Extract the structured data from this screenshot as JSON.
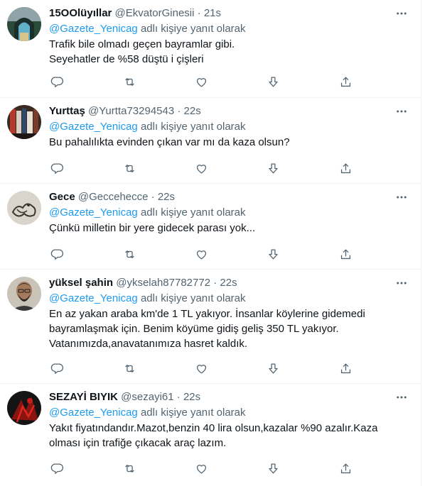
{
  "reply_prefix": "adlı kişiye yanıt olarak",
  "tweets": [
    {
      "name": "15OOlüyıllar",
      "handle": "@EkvatorGinesii",
      "time": "21s",
      "reply_to": "@Gazete_Yenicag",
      "lines": [
        "Trafik bile olmadı geçen bayramlar gibi.",
        "Seyehatler de %58 düştü i çişleri"
      ]
    },
    {
      "name": "Yurttaş",
      "handle": "@Yurtta73294543",
      "time": "22s",
      "reply_to": "@Gazete_Yenicag",
      "lines": [
        "Bu pahalılıkta evinden çıkan var mı da kaza olsun?"
      ]
    },
    {
      "name": "Gece",
      "handle": "@Geccehecce",
      "time": "22s",
      "reply_to": "@Gazete_Yenicag",
      "lines": [
        "Çünkü milletin bir yere gidecek parası yok..."
      ]
    },
    {
      "name": "yüksel şahin",
      "handle": "@ykselah87782772",
      "time": "22s",
      "reply_to": "@Gazete_Yenicag",
      "lines": [
        "En az yakan araba km'de 1 TL yakıyor. İnsanlar köylerine gidemedi",
        "bayramlaşmak için. Benim köyüme gidiş geliş 350 TL yakıyor.",
        "Vatanımızda,anavatanımıza hasret kaldık."
      ]
    },
    {
      "name": "SEZAYİ BIYIK",
      "handle": "@sezayi61",
      "time": "22s",
      "reply_to": "@Gazete_Yenicag",
      "lines": [
        "Yakıt fiyatındandır.Mazot,benzin 40 lira olsun,kazalar %90 azalır.Kaza",
        "olması için trafiğe çıkacak araç lazım."
      ]
    }
  ],
  "icons": {
    "more": "more-horizontal-icon",
    "reply": "reply-bubble-icon",
    "retweet": "retweet-icon",
    "like": "heart-icon",
    "dislike": "downvote-arrow-icon",
    "share": "share-upload-icon"
  },
  "colors": {
    "link": "#1d9bf0",
    "secondary_text": "#536471",
    "primary_text": "#0f1419",
    "divider": "#eff3f4"
  }
}
